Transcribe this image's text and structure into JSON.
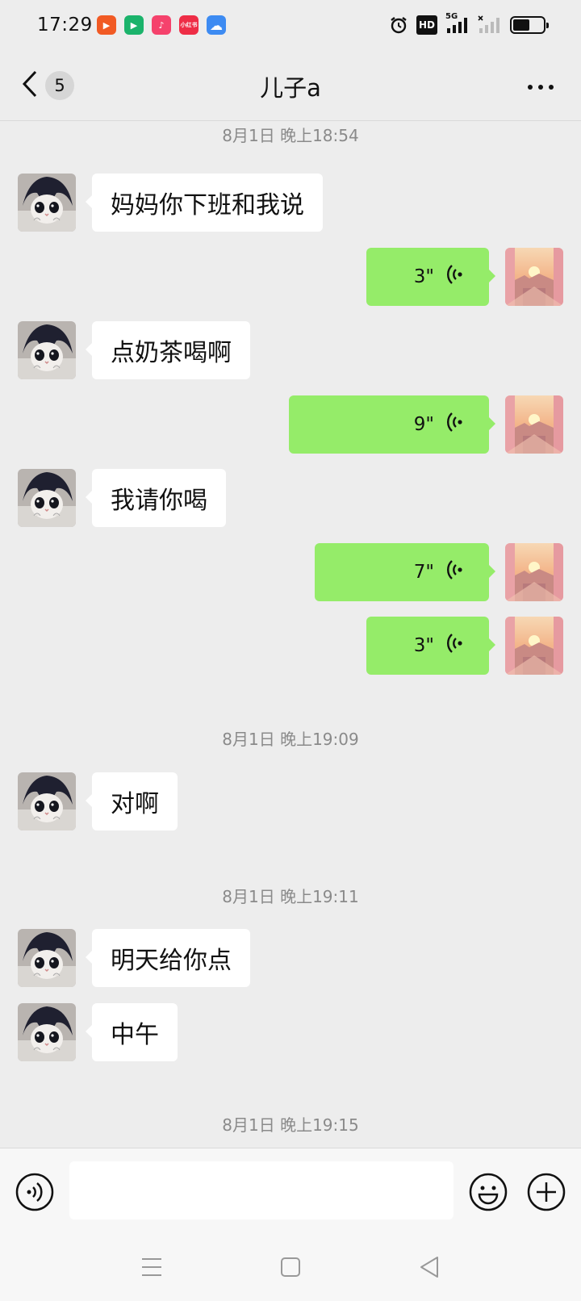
{
  "status_bar": {
    "time": "17:29",
    "apps": [
      {
        "icon": "video-app-icon",
        "color": "#f15a24",
        "glyph": "▶"
      },
      {
        "icon": "tencent-video-icon",
        "color": "#1bb36b",
        "glyph": "▶"
      },
      {
        "icon": "music-app-icon",
        "color": "#f5426c",
        "glyph": "♪"
      },
      {
        "icon": "xiaohongshu-icon",
        "color": "#ee2d46",
        "glyph": "小红书"
      },
      {
        "icon": "weather-app-icon",
        "color": "#3d8bf2",
        "glyph": "☁"
      }
    ],
    "hd_label": "HD",
    "network_label": "5G",
    "battery_level": 0.55
  },
  "header": {
    "unread_count": "5",
    "title": "儿子a"
  },
  "messages": [
    {
      "type": "time",
      "text": "8月1日 晚上18:54"
    },
    {
      "type": "text",
      "side": "left",
      "text": "妈妈你下班和我说"
    },
    {
      "type": "voice",
      "side": "right",
      "duration": "3\""
    },
    {
      "type": "text",
      "side": "left",
      "text": "点奶茶喝啊"
    },
    {
      "type": "voice",
      "side": "right",
      "duration": "9\""
    },
    {
      "type": "text",
      "side": "left",
      "text": "我请你喝"
    },
    {
      "type": "voice",
      "side": "right",
      "duration": "7\""
    },
    {
      "type": "voice",
      "side": "right",
      "duration": "3\""
    },
    {
      "type": "time",
      "text": "8月1日 晚上19:09"
    },
    {
      "type": "text",
      "side": "left",
      "text": "对啊"
    },
    {
      "type": "time",
      "text": "8月1日 晚上19:11"
    },
    {
      "type": "text",
      "side": "left",
      "text": "明天给你点"
    },
    {
      "type": "text",
      "side": "left",
      "text": "中午"
    },
    {
      "type": "time",
      "text": "8月1日 晚上19:15"
    }
  ],
  "input": {
    "placeholder": "",
    "value": ""
  },
  "colors": {
    "background": "#ededed",
    "sent_bubble": "#95ec69",
    "received_bubble": "#ffffff"
  }
}
